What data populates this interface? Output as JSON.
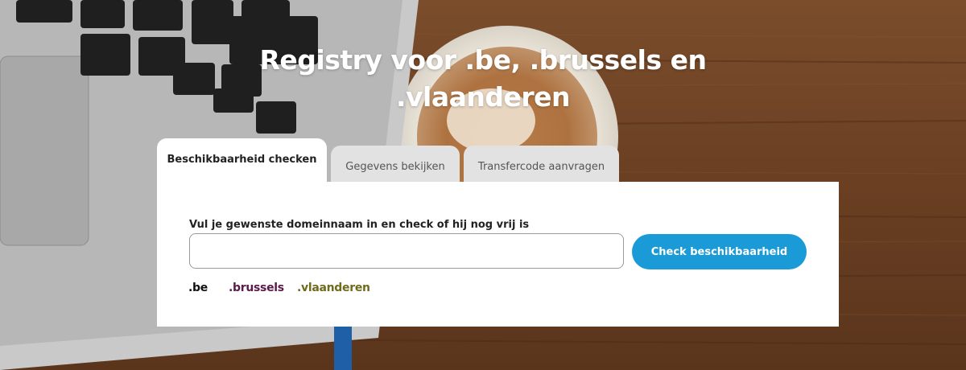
{
  "hero": {
    "title": "Registry voor .be, .brussels en .vlaanderen"
  },
  "tabs": [
    {
      "label": "Beschikbaarheid checken",
      "active": true
    },
    {
      "label": "Gegevens bekijken",
      "active": false
    },
    {
      "label": "Transfercode aanvragen",
      "active": false
    }
  ],
  "search": {
    "label": "Vul je gewenste domeinnaam in en check of hij nog vrij is",
    "value": "",
    "placeholder": "",
    "button_label": "Check beschikbaarheid"
  },
  "extensions": [
    {
      "label": ".be",
      "color": "#111111"
    },
    {
      "label": ".brussels",
      "color": "#5a1a4a"
    },
    {
      "label": ".vlaanderen",
      "color": "#6f6a1c"
    }
  ],
  "colors": {
    "accent": "#1a9ad6",
    "tab_inactive_bg": "#e2e2e2"
  }
}
